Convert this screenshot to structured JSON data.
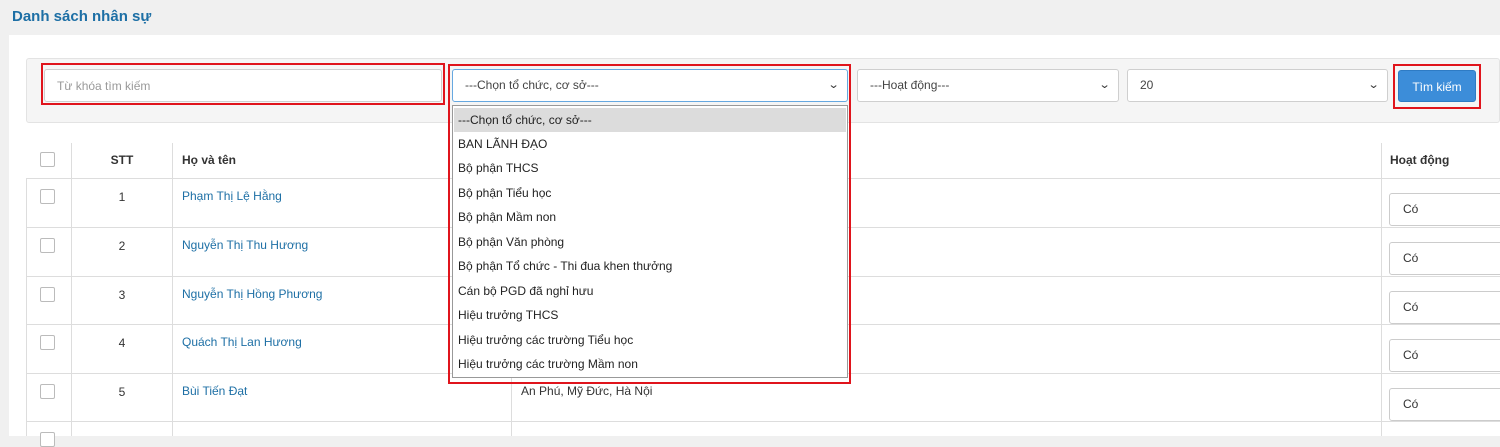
{
  "page": {
    "title": "Danh sách nhân sự"
  },
  "filters": {
    "keyword_placeholder": "Từ khóa tìm kiếm",
    "keyword_value": "",
    "org_selected": "---Chọn tổ chức, cơ sở---",
    "active_selected": "---Hoạt động---",
    "page_size_selected": "20",
    "search_button": "Tìm kiếm"
  },
  "org_dropdown": {
    "options": [
      "---Chọn tổ chức, cơ sở---",
      "BAN LÃNH ĐẠO",
      "Bộ phận THCS",
      "Bộ phận Tiểu học",
      "Bộ phận Mầm non",
      "Bộ phận Văn phòng",
      "Bộ phận Tổ chức - Thi đua khen thưởng",
      "Cán bộ PGD đã nghỉ hưu",
      "Hiệu trưởng THCS",
      "Hiệu trưởng các trường Tiểu học",
      "Hiệu trưởng các trường Mầm non"
    ],
    "highlighted_index": 0
  },
  "table": {
    "headers": {
      "stt": "STT",
      "name": "Họ và tên",
      "active": "Hoạt động"
    },
    "rows": [
      {
        "stt": "1",
        "name": "Phạm Thị Lệ Hằng",
        "address": "",
        "active": "Có"
      },
      {
        "stt": "2",
        "name": "Nguyễn Thị Thu Hương",
        "address": "",
        "active": "Có"
      },
      {
        "stt": "3",
        "name": "Nguyễn Thị Hồng Phương",
        "address": "",
        "active": "Có"
      },
      {
        "stt": "4",
        "name": "Quách Thị Lan Hương",
        "address": "",
        "active": "Có"
      },
      {
        "stt": "5",
        "name": "Bùi Tiến Đạt",
        "address": "An Phú, Mỹ Đức, Hà Nội",
        "active": "Có"
      }
    ]
  },
  "colors": {
    "title": "#1d6fa5",
    "link": "#1d6fa5",
    "primary_button": "#3c8dd9",
    "highlight_box": "#e0141c"
  },
  "icons": {
    "select_arrow": "chevron-down-icon"
  }
}
